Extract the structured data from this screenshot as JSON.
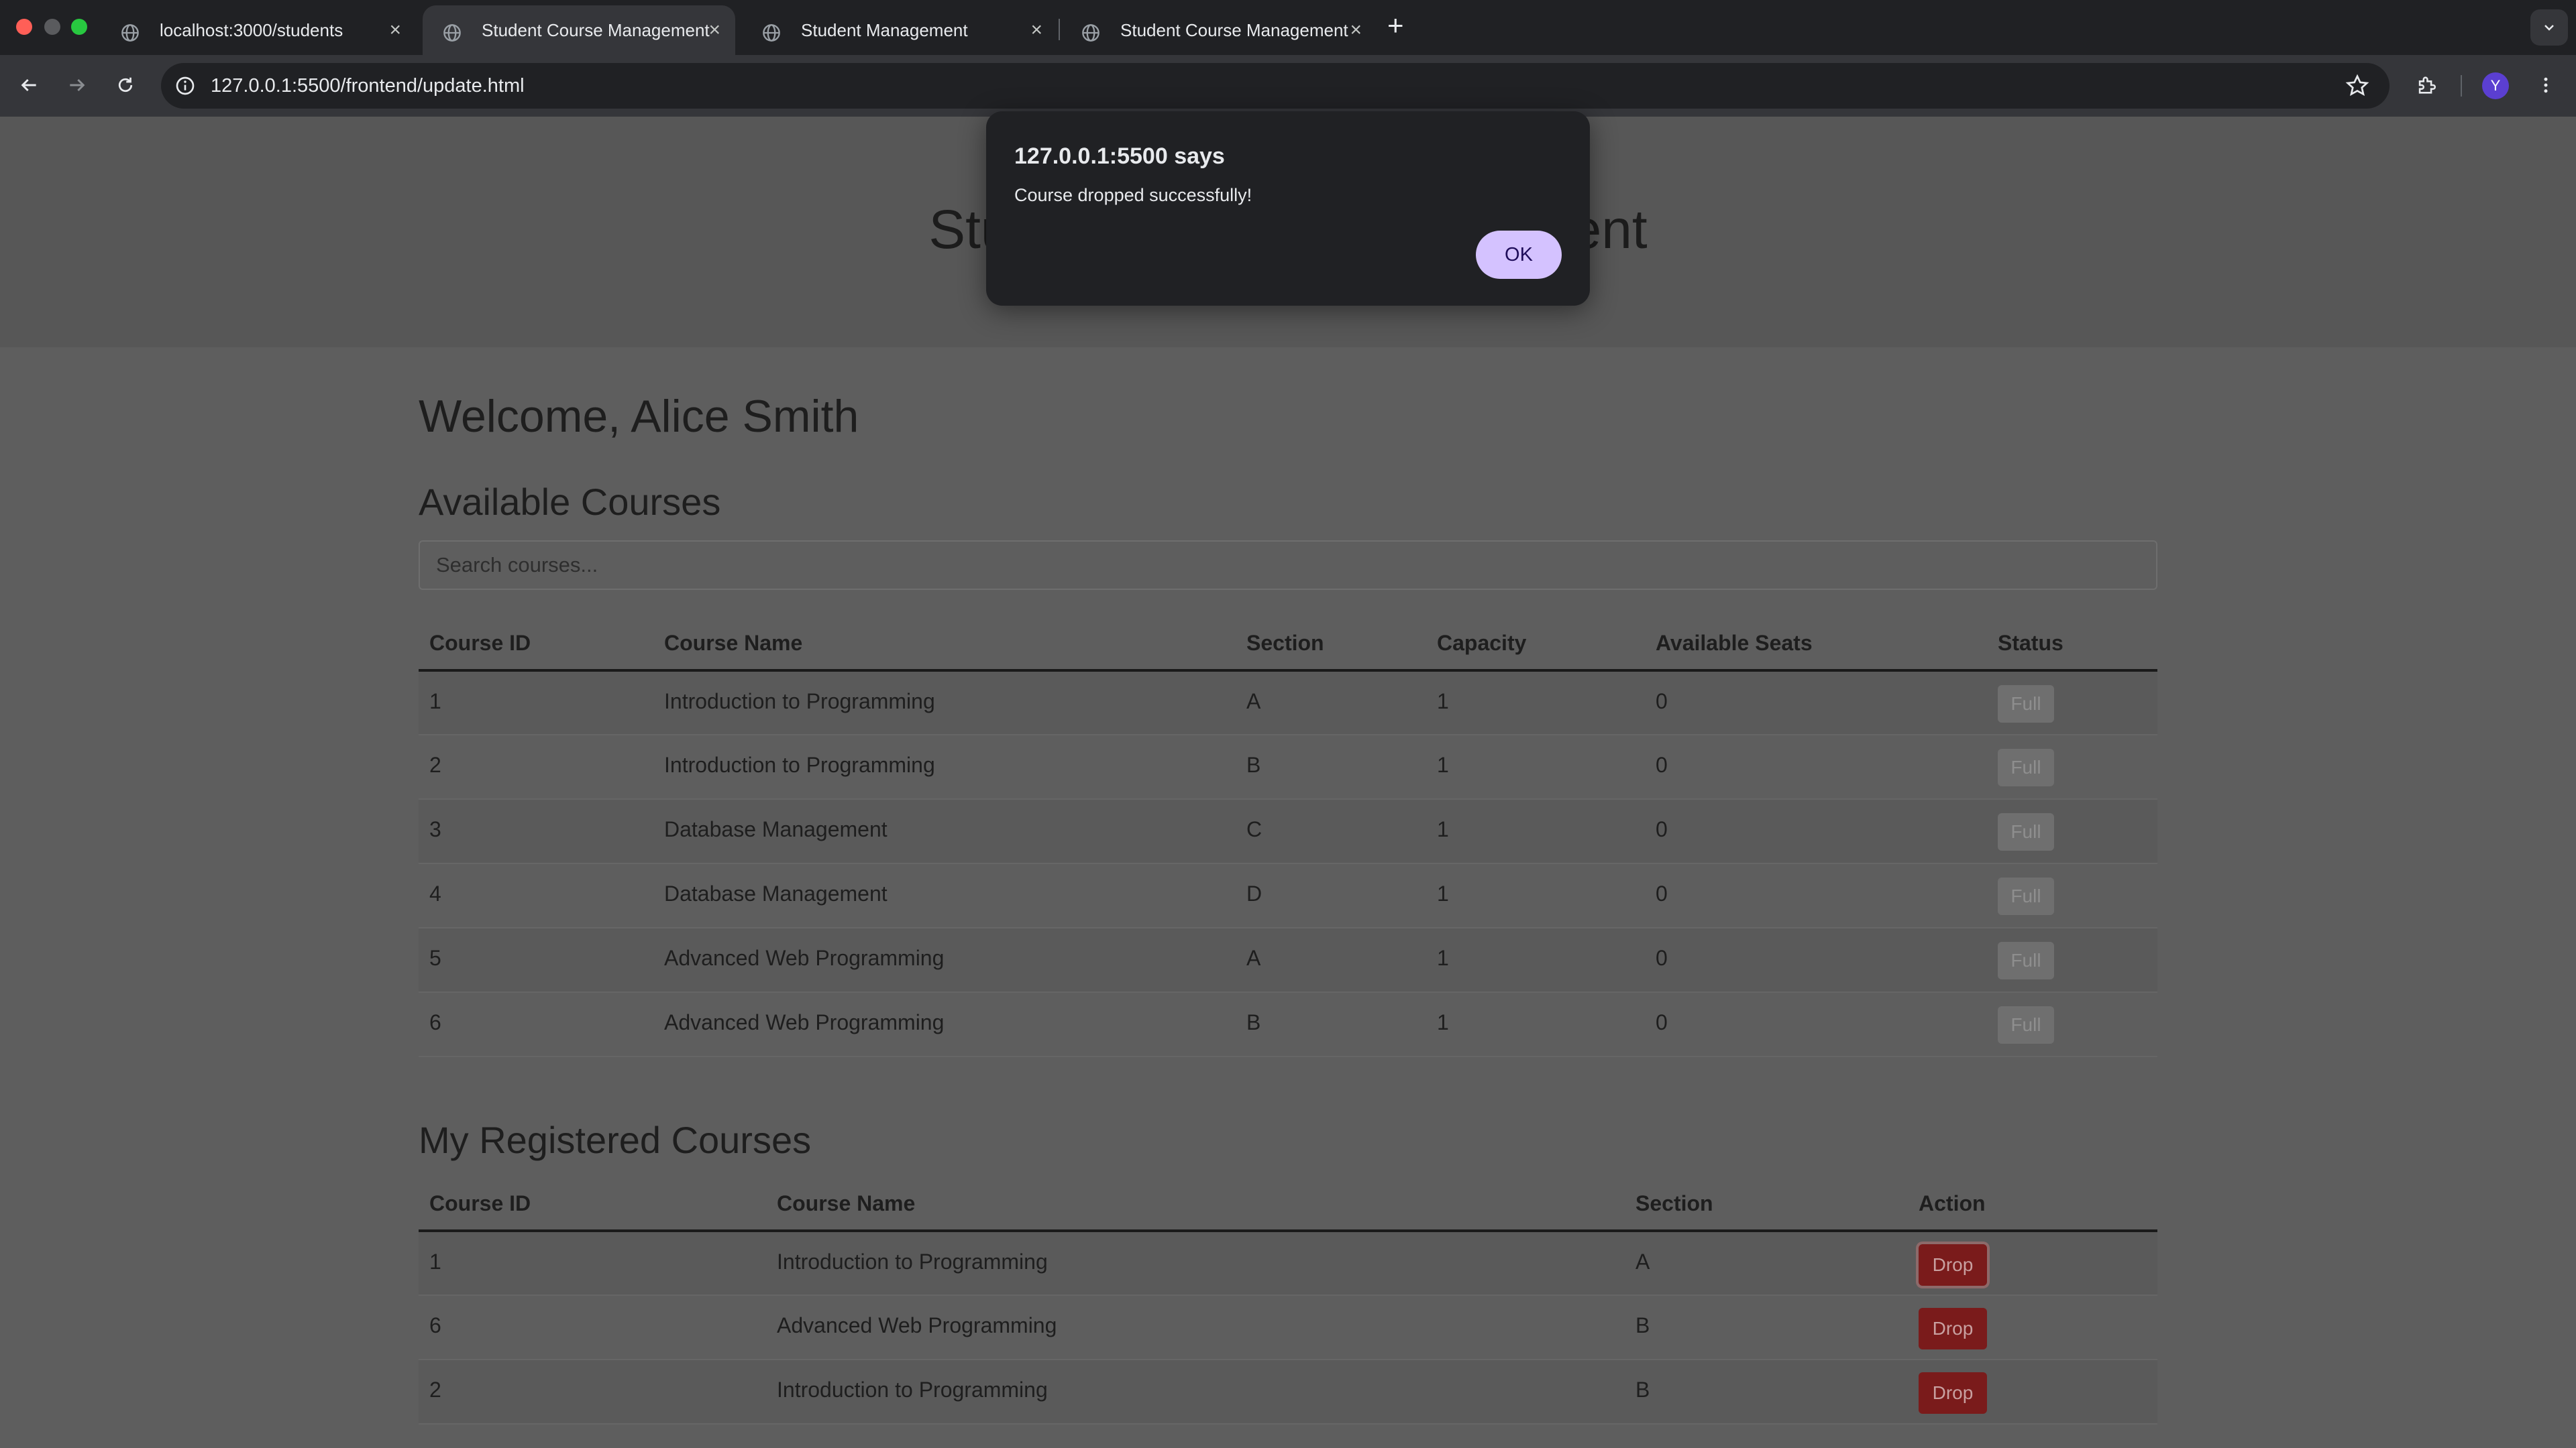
{
  "browser": {
    "tabs": [
      {
        "title": "localhost:3000/students",
        "active": false
      },
      {
        "title": "Student Course Management",
        "active": true
      },
      {
        "title": "Student Management",
        "active": false
      },
      {
        "title": "Student Course Management",
        "active": false
      }
    ],
    "url": "127.0.0.1:5500/frontend/update.html",
    "profile_initial": "Y"
  },
  "page": {
    "header_title": "Student Course Management",
    "welcome": "Welcome, Alice Smith",
    "available_title": "Available Courses",
    "search_placeholder": "Search courses...",
    "available_headers": [
      "Course ID",
      "Course Name",
      "Section",
      "Capacity",
      "Available Seats",
      "Status"
    ],
    "available_rows": [
      {
        "id": "1",
        "name": "Introduction to Programming",
        "section": "A",
        "capacity": "1",
        "seats": "0",
        "status": "Full"
      },
      {
        "id": "2",
        "name": "Introduction to Programming",
        "section": "B",
        "capacity": "1",
        "seats": "0",
        "status": "Full"
      },
      {
        "id": "3",
        "name": "Database Management",
        "section": "C",
        "capacity": "1",
        "seats": "0",
        "status": "Full"
      },
      {
        "id": "4",
        "name": "Database Management",
        "section": "D",
        "capacity": "1",
        "seats": "0",
        "status": "Full"
      },
      {
        "id": "5",
        "name": "Advanced Web Programming",
        "section": "A",
        "capacity": "1",
        "seats": "0",
        "status": "Full"
      },
      {
        "id": "6",
        "name": "Advanced Web Programming",
        "section": "B",
        "capacity": "1",
        "seats": "0",
        "status": "Full"
      }
    ],
    "registered_title": "My Registered Courses",
    "registered_headers": [
      "Course ID",
      "Course Name",
      "Section",
      "Action"
    ],
    "registered_rows": [
      {
        "id": "1",
        "name": "Introduction to Programming",
        "section": "A",
        "action": "Drop"
      },
      {
        "id": "6",
        "name": "Advanced Web Programming",
        "section": "B",
        "action": "Drop"
      },
      {
        "id": "2",
        "name": "Introduction to Programming",
        "section": "B",
        "action": "Drop"
      }
    ]
  },
  "dialog": {
    "title": "127.0.0.1:5500 says",
    "message": "Course dropped successfully!",
    "ok_label": "OK"
  },
  "colors": {
    "accent_ok": "#d4c2ff",
    "drop_button": "#7a1b1b",
    "chrome_dark": "#202124"
  }
}
